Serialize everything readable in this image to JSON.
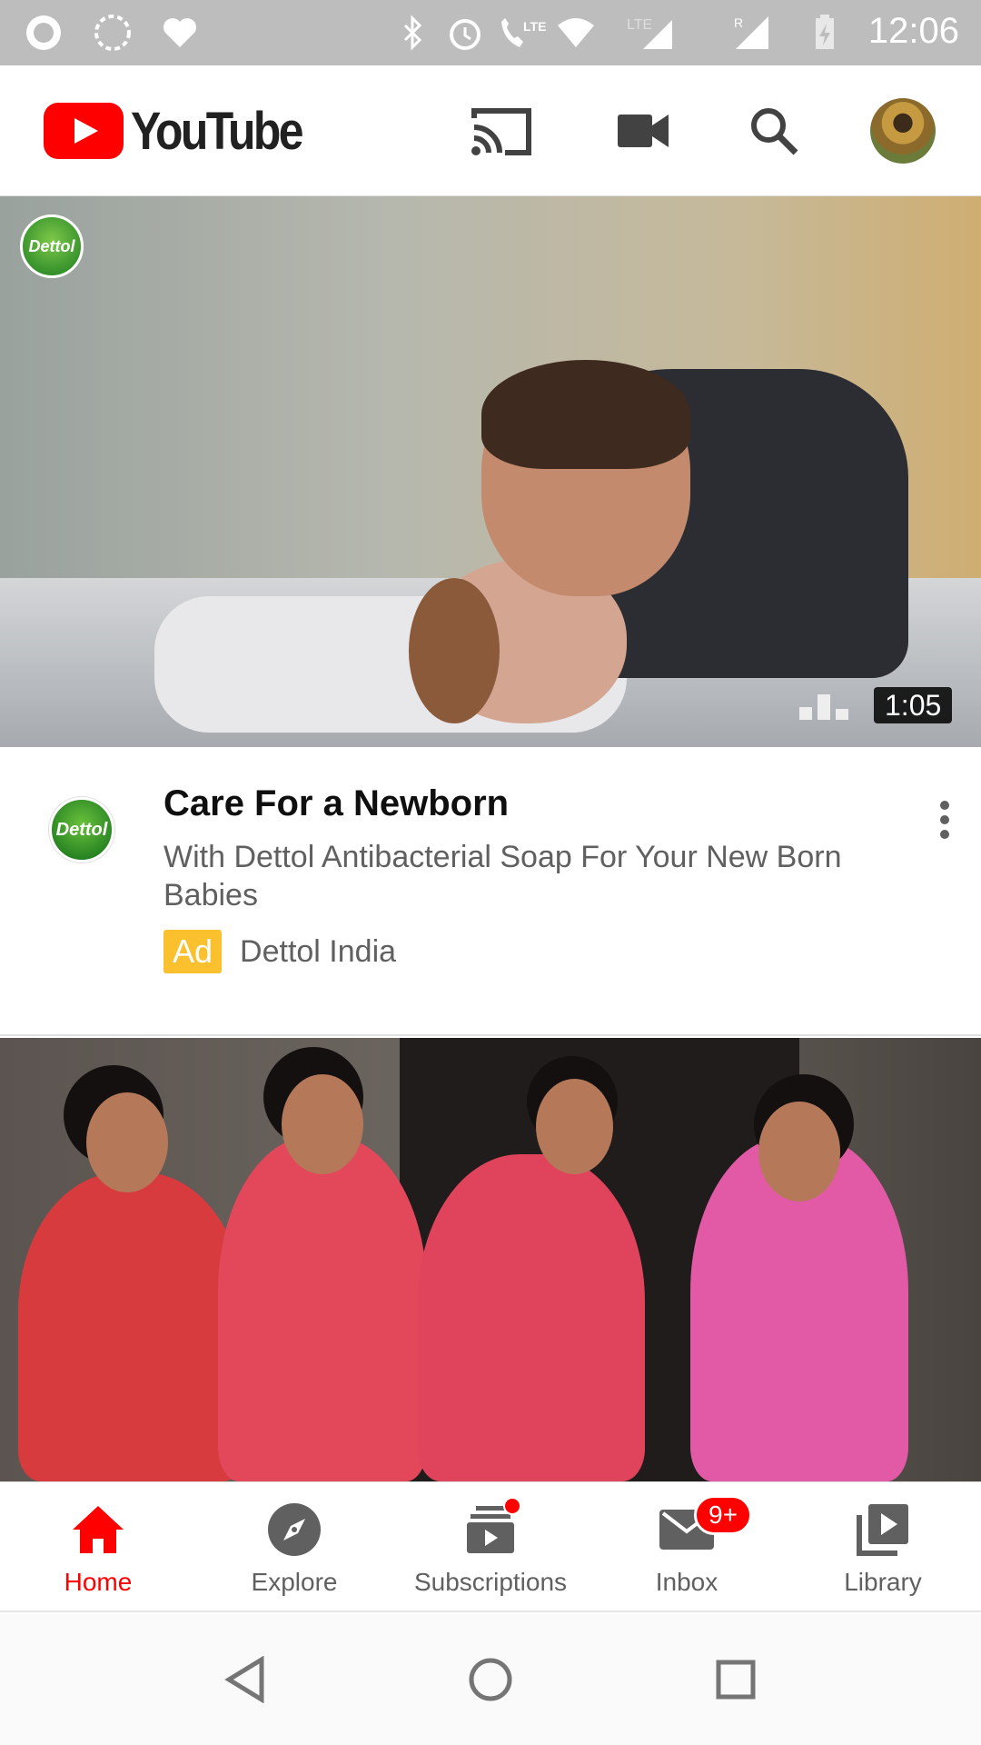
{
  "status_bar": {
    "time": "12:06",
    "icons": [
      "app-icon",
      "sync-icon",
      "health-icon",
      "bluetooth-icon",
      "alarm-icon",
      "lte-call-icon",
      "wifi-icon",
      "signal-icon",
      "signal-roaming-icon",
      "battery-charging-icon"
    ]
  },
  "header": {
    "logo_text": "YouTube",
    "cast_icon": "cast-icon",
    "camera_icon": "video-camera-icon",
    "search_icon": "search-icon"
  },
  "feed": {
    "videos": [
      {
        "duration": "1:05",
        "title": "Care For a Newborn",
        "description": "With Dettol Antibacterial Soap For Your New Born Babies",
        "ad_label": "Ad",
        "channel": "Dettol India",
        "badge_text": "Dettol"
      }
    ]
  },
  "bottom_nav": {
    "items": [
      {
        "label": "Home",
        "icon": "home-icon",
        "active": true
      },
      {
        "label": "Explore",
        "icon": "explore-icon",
        "active": false
      },
      {
        "label": "Subscriptions",
        "icon": "subscriptions-icon",
        "active": false
      },
      {
        "label": "Inbox",
        "icon": "inbox-icon",
        "active": false,
        "badge": "9+"
      },
      {
        "label": "Library",
        "icon": "library-icon",
        "active": false
      }
    ]
  },
  "colors": {
    "brand_red": "#ff0000",
    "ad_yellow": "#fbc02d",
    "text_primary": "#0f0f0f",
    "text_secondary": "#606060"
  }
}
